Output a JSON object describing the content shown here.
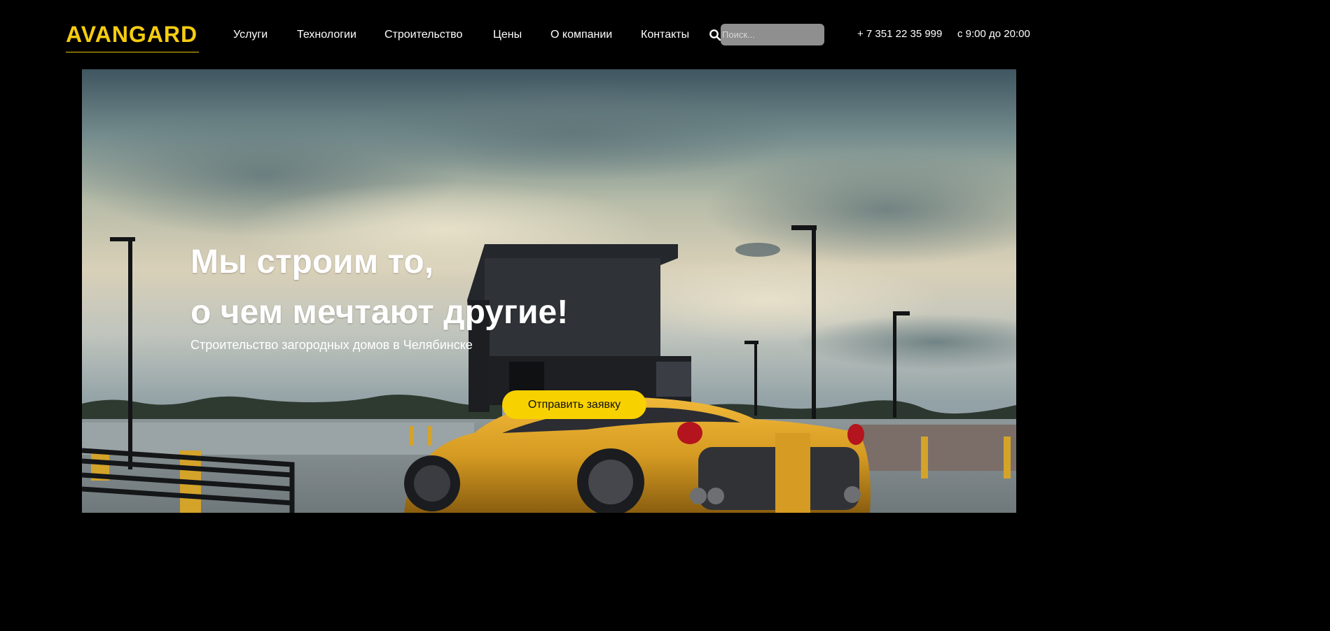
{
  "header": {
    "logo": "AVANGARD",
    "nav": [
      {
        "label": "Услуги"
      },
      {
        "label": "Технологии"
      },
      {
        "label": "Строительство"
      },
      {
        "label": "Цены"
      },
      {
        "label": "О компании"
      },
      {
        "label": "Контакты"
      }
    ],
    "search": {
      "placeholder": "Поиск...",
      "icon": "search-icon"
    },
    "phone": "+ 7 351 22 35 999",
    "hours": "с 9:00 до 20:00"
  },
  "hero": {
    "title_line1": "Мы строим то,",
    "title_line2": "о чем мечтают другие!",
    "subtitle": "Строительство загородных домов в Челябинске",
    "cta_label": "Отправить заявку"
  },
  "colors": {
    "accent": "#f5cc10",
    "background": "#000000",
    "button": "#f8d100",
    "search_bg": "#8f8f8f"
  }
}
